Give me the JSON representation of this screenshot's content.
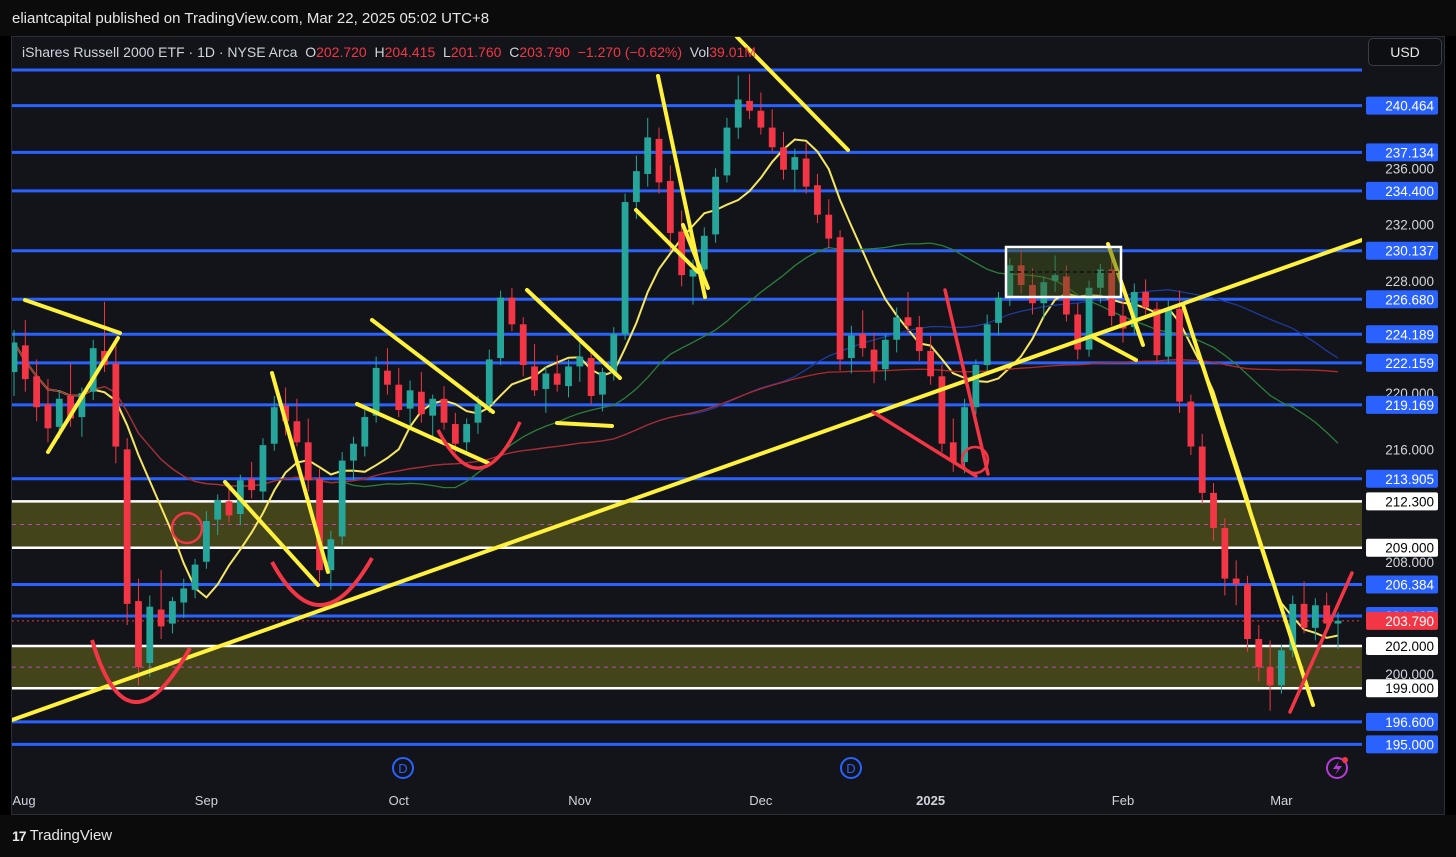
{
  "header": {
    "published": "eliantcapital published on TradingView.com, Mar 22, 2025 05:02 UTC+8"
  },
  "legend": {
    "title": "iShares Russell 2000 ETF · 1D · NYSE Arca",
    "o_label": "O",
    "o_value": "202.720",
    "h_label": "H",
    "h_value": "204.415",
    "l_label": "L",
    "l_value": "201.760",
    "c_label": "C",
    "c_value": "203.790",
    "change": "−1.270 (−0.62%)",
    "vol_label": "Vol",
    "vol_value": "39.01M"
  },
  "currency_button": "USD",
  "footer": {
    "brand": "TradingView",
    "logo": "17"
  },
  "event_marker_letter": "D",
  "chart_data": {
    "type": "candlestick",
    "symbol": "iShares Russell 2000 ETF",
    "interval": "1D",
    "exchange": "NYSE Arca",
    "y_axis": {
      "range": [
        193.0,
        243.0
      ],
      "tick_labels": [
        "236.000",
        "232.000",
        "228.000",
        "220.000",
        "216.000",
        "208.000",
        "200.000"
      ],
      "level_labels": [
        {
          "value": "240.464",
          "color": "#2962ff"
        },
        {
          "value": "237.134",
          "color": "#2962ff"
        },
        {
          "value": "234.400",
          "color": "#2962ff"
        },
        {
          "value": "230.137",
          "color": "#2962ff"
        },
        {
          "value": "226.680",
          "color": "#2962ff"
        },
        {
          "value": "224.189",
          "color": "#2962ff"
        },
        {
          "value": "222.159",
          "color": "#2962ff"
        },
        {
          "value": "219.169",
          "color": "#2962ff"
        },
        {
          "value": "213.905",
          "color": "#2962ff"
        },
        {
          "value": "212.300",
          "color": "#ffffff"
        },
        {
          "value": "209.000",
          "color": "#ffffff"
        },
        {
          "value": "206.384",
          "color": "#2962ff"
        },
        {
          "value": "204.137",
          "color": "#2962ff"
        },
        {
          "value": "203.790",
          "color": "#f23645"
        },
        {
          "value": "202.000",
          "color": "#ffffff"
        },
        {
          "value": "199.000",
          "color": "#ffffff"
        },
        {
          "value": "196.600",
          "color": "#2962ff"
        },
        {
          "value": "195.000",
          "color": "#2962ff"
        }
      ]
    },
    "x_axis": {
      "labels": [
        "Aug",
        "Sep",
        "Oct",
        "Nov",
        "Dec",
        "2025",
        "Feb",
        "Mar"
      ],
      "bold_label": "2025"
    },
    "horizontal_levels_blue": [
      243.0,
      240.464,
      237.134,
      234.4,
      230.137,
      226.68,
      224.189,
      222.159,
      219.169,
      213.905,
      206.384,
      204.137,
      196.6,
      195.0
    ],
    "horizontal_levels_white": [
      212.3,
      209.0,
      202.0,
      199.0
    ],
    "zones": [
      {
        "from": 209.0,
        "to": 212.3,
        "color": "#6b6b1a"
      },
      {
        "from": 199.0,
        "to": 202.0,
        "color": "#6b6b1a"
      }
    ],
    "last_price": 203.79,
    "moving_averages": [
      {
        "color": "#f5e663"
      },
      {
        "color": "#2d7d3a"
      },
      {
        "color": "#1e3a9a"
      },
      {
        "color": "#b02a2a"
      }
    ],
    "candles": [
      [
        0,
        221.5,
        224.5,
        219.8,
        223.6
      ],
      [
        1,
        223.4,
        225.2,
        220.1,
        221.0
      ],
      [
        2,
        221.2,
        222.4,
        218.0,
        219.0
      ],
      [
        3,
        219.2,
        221.0,
        216.5,
        217.5
      ],
      [
        4,
        217.6,
        220.2,
        216.8,
        219.6
      ],
      [
        5,
        219.8,
        222.1,
        217.6,
        218.2
      ],
      [
        6,
        218.3,
        220.4,
        216.9,
        220.0
      ],
      [
        7,
        220.1,
        223.8,
        219.5,
        223.2
      ],
      [
        8,
        223.0,
        226.5,
        221.5,
        222.0
      ],
      [
        9,
        222.1,
        223.4,
        215.0,
        216.2
      ],
      [
        10,
        216.0,
        216.8,
        203.5,
        205.0
      ],
      [
        11,
        205.2,
        206.8,
        199.2,
        200.5
      ],
      [
        12,
        200.8,
        205.6,
        199.8,
        204.8
      ],
      [
        13,
        204.6,
        207.4,
        202.5,
        203.4
      ],
      [
        14,
        203.6,
        205.5,
        202.9,
        205.2
      ],
      [
        15,
        205.1,
        206.8,
        204.0,
        206.1
      ],
      [
        16,
        206.0,
        208.2,
        205.4,
        207.8
      ],
      [
        17,
        208.0,
        211.6,
        207.5,
        210.9
      ],
      [
        18,
        211.0,
        212.8,
        209.9,
        212.4
      ],
      [
        19,
        212.3,
        213.6,
        210.8,
        211.3
      ],
      [
        20,
        211.4,
        214.2,
        210.6,
        213.8
      ],
      [
        21,
        213.9,
        215.1,
        212.5,
        213.1
      ],
      [
        22,
        213.0,
        216.8,
        212.4,
        216.3
      ],
      [
        23,
        216.4,
        219.8,
        215.9,
        219.0
      ],
      [
        24,
        219.1,
        220.4,
        217.0,
        218.0
      ],
      [
        25,
        218.0,
        219.6,
        216.2,
        216.5
      ],
      [
        26,
        216.5,
        218.2,
        213.0,
        213.8
      ],
      [
        27,
        213.9,
        214.6,
        206.6,
        207.4
      ],
      [
        28,
        207.4,
        210.2,
        206.0,
        209.6
      ],
      [
        29,
        209.8,
        215.8,
        209.2,
        215.2
      ],
      [
        30,
        215.2,
        216.9,
        213.8,
        216.4
      ],
      [
        31,
        216.2,
        218.8,
        215.5,
        218.3
      ],
      [
        32,
        218.4,
        222.6,
        217.9,
        221.8
      ],
      [
        33,
        221.6,
        223.2,
        219.9,
        220.6
      ],
      [
        34,
        220.6,
        221.8,
        218.3,
        218.8
      ],
      [
        35,
        218.9,
        220.9,
        217.5,
        220.2
      ],
      [
        36,
        220.1,
        221.5,
        217.9,
        218.5
      ],
      [
        37,
        218.4,
        219.9,
        216.8,
        219.6
      ],
      [
        38,
        219.6,
        220.5,
        217.4,
        217.9
      ],
      [
        39,
        217.8,
        218.6,
        215.8,
        216.4
      ],
      [
        40,
        216.5,
        218.2,
        215.9,
        217.8
      ],
      [
        41,
        217.9,
        219.8,
        217.1,
        219.2
      ],
      [
        42,
        219.2,
        223.1,
        218.6,
        222.4
      ],
      [
        43,
        222.5,
        227.3,
        222.0,
        226.8
      ],
      [
        44,
        226.8,
        227.5,
        224.4,
        224.9
      ],
      [
        45,
        224.9,
        225.4,
        221.2,
        222.0
      ],
      [
        46,
        221.9,
        223.5,
        219.8,
        220.2
      ],
      [
        47,
        220.3,
        221.9,
        218.6,
        221.4
      ],
      [
        48,
        221.4,
        222.7,
        220.1,
        220.6
      ],
      [
        49,
        220.5,
        222.4,
        219.7,
        221.9
      ],
      [
        50,
        221.9,
        223.6,
        220.8,
        222.6
      ],
      [
        51,
        222.5,
        223.1,
        219.2,
        219.8
      ],
      [
        52,
        219.9,
        221.8,
        218.7,
        221.5
      ],
      [
        53,
        221.4,
        224.7,
        220.9,
        224.2
      ],
      [
        54,
        224.2,
        234.2,
        223.8,
        233.6
      ],
      [
        55,
        233.6,
        236.9,
        232.4,
        235.8
      ],
      [
        56,
        235.6,
        239.6,
        234.7,
        238.2
      ],
      [
        57,
        238.1,
        238.9,
        234.2,
        235.0
      ],
      [
        58,
        235.1,
        236.2,
        230.1,
        231.4
      ],
      [
        59,
        231.5,
        233.0,
        227.6,
        228.4
      ],
      [
        60,
        228.3,
        229.5,
        226.3,
        228.8
      ],
      [
        61,
        228.8,
        231.8,
        228.2,
        231.2
      ],
      [
        62,
        231.3,
        236.0,
        230.7,
        235.4
      ],
      [
        63,
        235.5,
        239.6,
        235.0,
        238.9
      ],
      [
        64,
        238.9,
        242.6,
        238.1,
        240.9
      ],
      [
        65,
        240.8,
        242.7,
        239.5,
        240.1
      ],
      [
        66,
        240.1,
        241.4,
        238.4,
        238.9
      ],
      [
        67,
        238.9,
        240.2,
        237.1,
        237.5
      ],
      [
        68,
        237.5,
        238.6,
        235.2,
        235.9
      ],
      [
        69,
        235.9,
        237.4,
        234.3,
        236.8
      ],
      [
        70,
        236.7,
        237.8,
        234.2,
        234.7
      ],
      [
        71,
        234.8,
        235.6,
        232.1,
        232.7
      ],
      [
        72,
        232.7,
        233.8,
        230.3,
        231.0
      ],
      [
        73,
        231.1,
        231.6,
        221.6,
        222.4
      ],
      [
        74,
        222.5,
        224.8,
        221.4,
        224.1
      ],
      [
        75,
        224.2,
        225.9,
        222.6,
        223.2
      ],
      [
        76,
        223.1,
        224.3,
        220.7,
        221.6
      ],
      [
        77,
        221.7,
        224.2,
        220.9,
        223.8
      ],
      [
        78,
        223.8,
        226.1,
        222.9,
        225.4
      ],
      [
        79,
        225.4,
        227.2,
        224.2,
        224.8
      ],
      [
        80,
        224.7,
        225.5,
        222.3,
        223.0
      ],
      [
        81,
        223.0,
        224.1,
        220.6,
        221.2
      ],
      [
        82,
        221.2,
        222.0,
        215.8,
        216.4
      ],
      [
        83,
        216.5,
        218.2,
        214.4,
        215.1
      ],
      [
        84,
        215.1,
        219.6,
        214.3,
        219.0
      ],
      [
        85,
        219.0,
        222.4,
        218.5,
        222.0
      ],
      [
        86,
        222.0,
        225.6,
        221.6,
        224.9
      ],
      [
        87,
        225.0,
        227.2,
        224.1,
        226.8
      ],
      [
        88,
        226.9,
        229.6,
        226.2,
        229.1
      ],
      [
        89,
        229.1,
        230.2,
        227.1,
        227.7
      ],
      [
        90,
        227.7,
        228.9,
        225.6,
        226.4
      ],
      [
        91,
        226.4,
        228.3,
        225.3,
        227.9
      ],
      [
        92,
        228.0,
        229.8,
        227.2,
        228.4
      ],
      [
        93,
        228.3,
        229.1,
        225.1,
        225.6
      ],
      [
        94,
        225.6,
        226.4,
        222.4,
        223.1
      ],
      [
        95,
        223.1,
        228.0,
        222.6,
        227.5
      ],
      [
        96,
        227.5,
        229.2,
        226.4,
        228.8
      ],
      [
        97,
        228.8,
        230.1,
        224.8,
        225.5
      ],
      [
        98,
        225.5,
        226.6,
        223.6,
        224.6
      ],
      [
        99,
        224.7,
        227.8,
        224.2,
        227.2
      ],
      [
        100,
        227.2,
        228.1,
        225.6,
        226.1
      ],
      [
        101,
        226.0,
        226.5,
        222.1,
        222.7
      ],
      [
        102,
        222.6,
        226.6,
        222.1,
        226.0
      ],
      [
        103,
        226.0,
        227.3,
        218.6,
        219.4
      ],
      [
        104,
        219.4,
        219.9,
        215.6,
        216.2
      ],
      [
        105,
        216.2,
        217.1,
        212.1,
        212.9
      ],
      [
        106,
        212.9,
        213.6,
        209.5,
        210.4
      ],
      [
        107,
        210.4,
        211.1,
        205.6,
        206.8
      ],
      [
        108,
        206.8,
        208.1,
        204.9,
        206.4
      ],
      [
        109,
        206.4,
        207.0,
        201.6,
        202.5
      ],
      [
        110,
        202.5,
        203.5,
        199.5,
        200.5
      ],
      [
        111,
        200.5,
        202.4,
        197.4,
        199.2
      ],
      [
        112,
        199.2,
        202.1,
        198.6,
        201.7
      ],
      [
        113,
        201.7,
        205.6,
        201.2,
        205.0
      ],
      [
        114,
        205.0,
        206.6,
        202.9,
        203.3
      ],
      [
        115,
        203.3,
        205.4,
        202.4,
        204.9
      ],
      [
        116,
        204.9,
        205.8,
        203.3,
        203.6
      ],
      [
        117,
        203.6,
        204.4,
        201.8,
        203.8
      ]
    ],
    "candle_x_range": [
      14,
      1338
    ],
    "colors": {
      "up": "#26a69a",
      "down": "#f23645",
      "annotation_yellow": "#fff13c",
      "annotation_red": "#f23645"
    }
  }
}
